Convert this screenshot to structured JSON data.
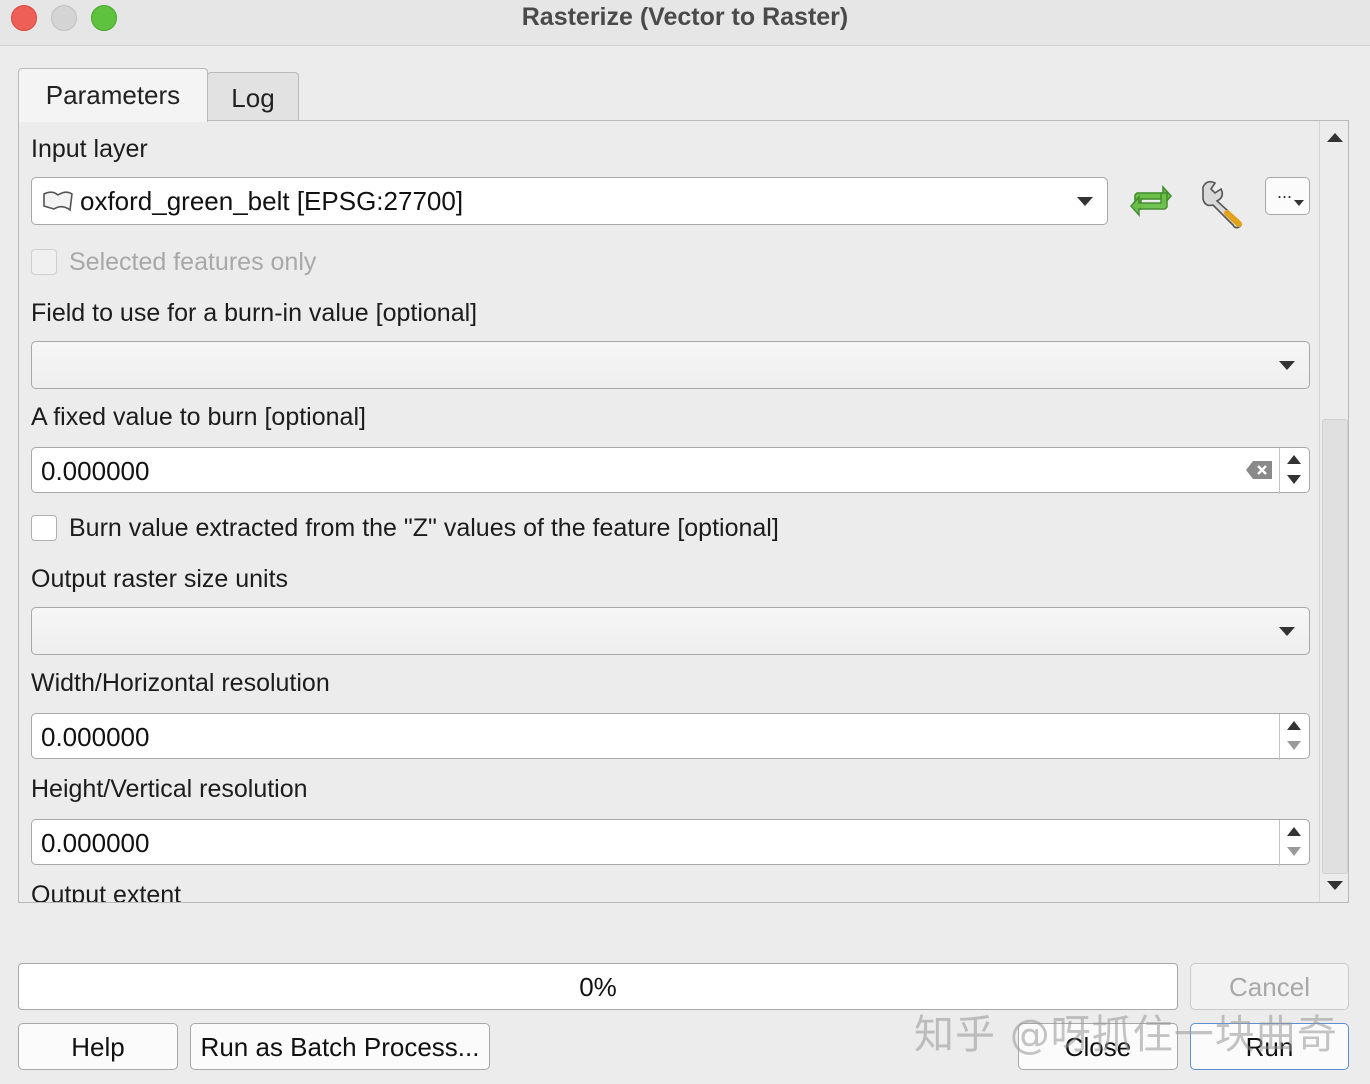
{
  "window": {
    "title": "Rasterize (Vector to Raster)"
  },
  "tabs": [
    {
      "label": "Parameters",
      "active": true
    },
    {
      "label": "Log",
      "active": false
    }
  ],
  "params": {
    "input_layer": {
      "label": "Input layer",
      "value": "oxford_green_belt [EPSG:27700]",
      "more_button": "..."
    },
    "selected_only": {
      "label": "Selected features only",
      "checked": false,
      "enabled": false
    },
    "burn_field": {
      "label": "Field to use for a burn-in value [optional]",
      "value": ""
    },
    "fixed_value": {
      "label": "A fixed value to burn [optional]",
      "value": "0.000000"
    },
    "burn_z": {
      "label": "Burn value extracted from the \"Z\" values of the feature [optional]",
      "checked": false
    },
    "size_units": {
      "label": "Output raster size units",
      "value": ""
    },
    "width_res": {
      "label": "Width/Horizontal resolution",
      "value": "0.000000"
    },
    "height_res": {
      "label": "Height/Vertical resolution",
      "value": "0.000000"
    },
    "extent": {
      "label": "Output extent"
    }
  },
  "footer": {
    "progress_text": "0%",
    "progress_value": 0,
    "cancel_label": "Cancel",
    "help_label": "Help",
    "batch_label": "Run as Batch Process...",
    "close_label": "Close",
    "run_label": "Run"
  },
  "watermark": "知乎 @呀抓住一块曲奇",
  "colors": {
    "accent": "#5b8fd6",
    "refresh_icon": "#4fae3c"
  }
}
